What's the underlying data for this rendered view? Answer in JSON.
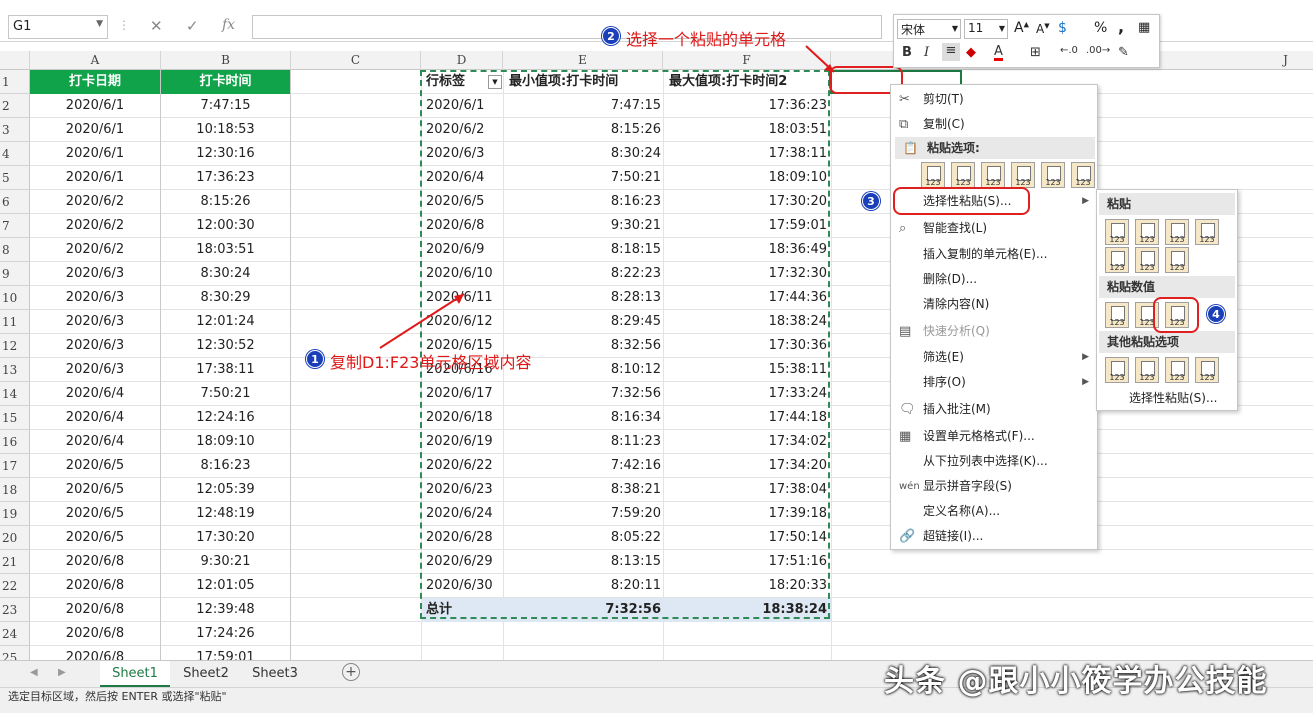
{
  "formula_bar": {
    "name_box": "G1",
    "cancel_glyph": "✕",
    "enter_glyph": "✓",
    "fx_glyph": "fx"
  },
  "columns": [
    "A",
    "B",
    "C",
    "D",
    "E",
    "F",
    "J"
  ],
  "rows": [
    "1",
    "2",
    "3",
    "4",
    "5",
    "6",
    "7",
    "8",
    "9",
    "10",
    "11",
    "12",
    "13",
    "14",
    "15",
    "16",
    "17",
    "18",
    "19",
    "20",
    "21",
    "22",
    "23",
    "24",
    "25"
  ],
  "source_table": {
    "headers": [
      "打卡日期",
      "打卡时间"
    ],
    "rows": [
      [
        "2020/6/1",
        "7:47:15"
      ],
      [
        "2020/6/1",
        "10:18:53"
      ],
      [
        "2020/6/1",
        "12:30:16"
      ],
      [
        "2020/6/1",
        "17:36:23"
      ],
      [
        "2020/6/2",
        "8:15:26"
      ],
      [
        "2020/6/2",
        "12:00:30"
      ],
      [
        "2020/6/2",
        "18:03:51"
      ],
      [
        "2020/6/3",
        "8:30:24"
      ],
      [
        "2020/6/3",
        "8:30:29"
      ],
      [
        "2020/6/3",
        "12:01:24"
      ],
      [
        "2020/6/3",
        "12:30:52"
      ],
      [
        "2020/6/3",
        "17:38:11"
      ],
      [
        "2020/6/4",
        "7:50:21"
      ],
      [
        "2020/6/4",
        "12:24:16"
      ],
      [
        "2020/6/4",
        "18:09:10"
      ],
      [
        "2020/6/5",
        "8:16:23"
      ],
      [
        "2020/6/5",
        "12:05:39"
      ],
      [
        "2020/6/5",
        "12:48:19"
      ],
      [
        "2020/6/5",
        "17:30:20"
      ],
      [
        "2020/6/8",
        "9:30:21"
      ],
      [
        "2020/6/8",
        "12:01:05"
      ],
      [
        "2020/6/8",
        "12:39:48"
      ],
      [
        "2020/6/8",
        "17:24:26"
      ],
      [
        "2020/6/8",
        "17:59:01"
      ]
    ]
  },
  "pivot": {
    "headers": [
      "行标签",
      "最小值项:打卡时间",
      "最大值项:打卡时间2"
    ],
    "rows": [
      [
        "2020/6/1",
        "7:47:15",
        "17:36:23"
      ],
      [
        "2020/6/2",
        "8:15:26",
        "18:03:51"
      ],
      [
        "2020/6/3",
        "8:30:24",
        "17:38:11"
      ],
      [
        "2020/6/4",
        "7:50:21",
        "18:09:10"
      ],
      [
        "2020/6/5",
        "8:16:23",
        "17:30:20"
      ],
      [
        "2020/6/8",
        "9:30:21",
        "17:59:01"
      ],
      [
        "2020/6/9",
        "8:18:15",
        "18:36:49"
      ],
      [
        "2020/6/10",
        "8:22:23",
        "17:32:30"
      ],
      [
        "2020/6/11",
        "8:28:13",
        "17:44:36"
      ],
      [
        "2020/6/12",
        "8:29:45",
        "18:38:24"
      ],
      [
        "2020/6/15",
        "8:32:56",
        "17:30:36"
      ],
      [
        "2020/6/16",
        "8:10:12",
        "15:38:11"
      ],
      [
        "2020/6/17",
        "7:32:56",
        "17:33:24"
      ],
      [
        "2020/6/18",
        "8:16:34",
        "17:44:18"
      ],
      [
        "2020/6/19",
        "8:11:23",
        "17:34:02"
      ],
      [
        "2020/6/22",
        "7:42:16",
        "17:34:20"
      ],
      [
        "2020/6/23",
        "8:38:21",
        "17:38:04"
      ],
      [
        "2020/6/24",
        "7:59:20",
        "17:39:18"
      ],
      [
        "2020/6/28",
        "8:05:22",
        "17:50:14"
      ],
      [
        "2020/6/29",
        "8:13:15",
        "17:51:16"
      ],
      [
        "2020/6/30",
        "8:20:11",
        "18:20:33"
      ]
    ],
    "total": [
      "总计",
      "7:32:56",
      "18:38:24"
    ]
  },
  "mini_toolbar": {
    "font": "宋体",
    "size": "11",
    "bold": "B",
    "italic": "I",
    "percent": "%",
    "comma": ","
  },
  "context_menu": {
    "cut": "剪切(T)",
    "copy": "复制(C)",
    "paste_options": "粘贴选项:",
    "paste_special": "选择性粘贴(S)...",
    "smart_lookup": "智能查找(L)",
    "insert_copied": "插入复制的单元格(E)...",
    "delete": "删除(D)...",
    "clear": "清除内容(N)",
    "quick_analysis": "快速分析(Q)",
    "filter": "筛选(E)",
    "sort": "排序(O)",
    "insert_comment": "插入批注(M)",
    "format_cells": "设置单元格格式(F)...",
    "pick_list": "从下拉列表中选择(K)...",
    "phonetic": "显示拼音字段(S)",
    "define_name": "定义名称(A)...",
    "hyperlink": "超链接(I)..."
  },
  "submenu": {
    "paste": "粘贴",
    "paste_values": "粘贴数值",
    "other_paste": "其他粘贴选项",
    "paste_special": "选择性粘贴(S)..."
  },
  "paste_icon_label": "123",
  "annotations": {
    "step1": "复制D1:F23单元格区域内容",
    "step2": "选择一个粘贴的单元格",
    "n1": "1",
    "n2": "2",
    "n3": "3",
    "n4": "4"
  },
  "sheets": [
    "Sheet1",
    "Sheet2",
    "Sheet3"
  ],
  "status": "选定目标区域，然后按 ENTER 或选择\"粘贴\"",
  "watermark": "头条 @跟小小筱学办公技能",
  "colors": {
    "header_green": "#10a34a",
    "excel_green": "#1e7a45",
    "annotation_red": "#e01818",
    "badge_blue": "#1b3fb8"
  }
}
